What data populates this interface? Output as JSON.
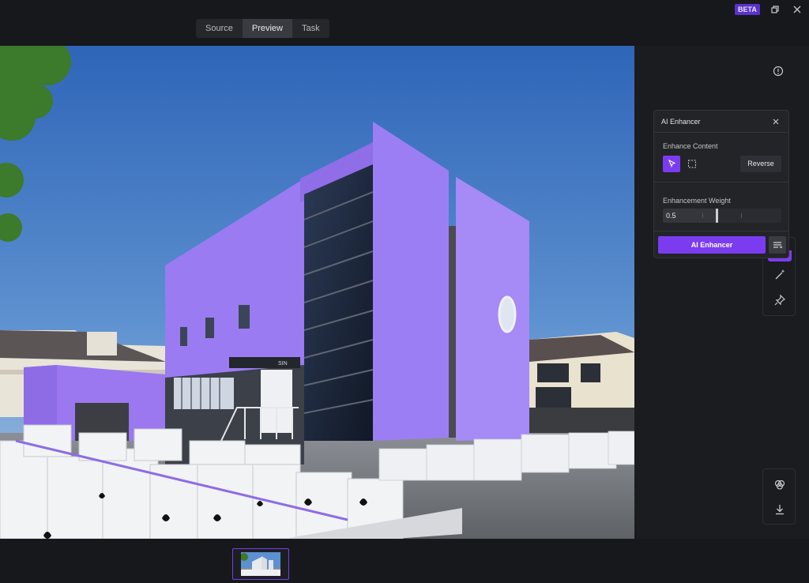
{
  "header": {
    "tabs": [
      {
        "label": "Source",
        "active": false
      },
      {
        "label": "Preview",
        "active": true
      },
      {
        "label": "Task",
        "active": false
      }
    ],
    "badge": "BETA",
    "window_controls": [
      "restore-icon",
      "close-icon"
    ]
  },
  "canvas": {
    "image_description_icon": "building-render",
    "sign_text": "SIN"
  },
  "enhancer_panel": {
    "title": "AI Enhancer",
    "content_label": "Enhance Content",
    "reverse_label": "Reverse",
    "weight_label": "Enhancement Weight",
    "weight_value": "0.5",
    "weight_fraction": 0.45,
    "action_label": "AI Enhancer"
  },
  "colors": {
    "accent": "#7b3cf0",
    "background": "#17181b",
    "panel": "#232428"
  },
  "tools": [
    "info-icon",
    "magic-wand-icon",
    "pin-icon",
    "layers-icon",
    "download-icon"
  ]
}
